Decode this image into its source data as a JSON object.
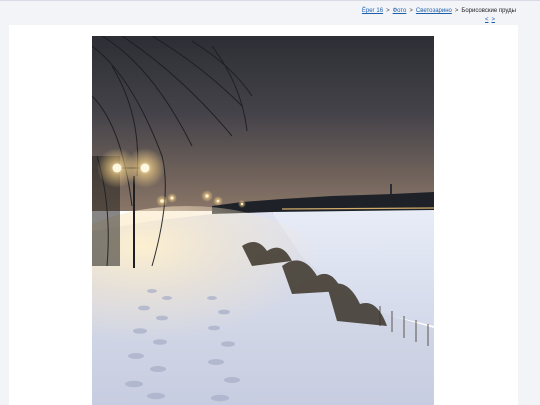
{
  "breadcrumb": {
    "items": [
      {
        "label": "Ёрег 16",
        "link": true
      },
      {
        "label": "Фото",
        "link": true
      },
      {
        "label": "Светозарино",
        "link": true
      },
      {
        "label": "Борисовские пруды",
        "link": false
      }
    ],
    "separator": ">"
  },
  "pager": {
    "prev": "<",
    "next": ">"
  },
  "photo": {
    "alt": "Зимний парк ночью",
    "subject": "snowy park path at night with street lamps by a frozen pond"
  },
  "colors": {
    "link": "#1c5fa8",
    "page_bg": "#f3f4f8",
    "card_bg": "#ffffff"
  }
}
